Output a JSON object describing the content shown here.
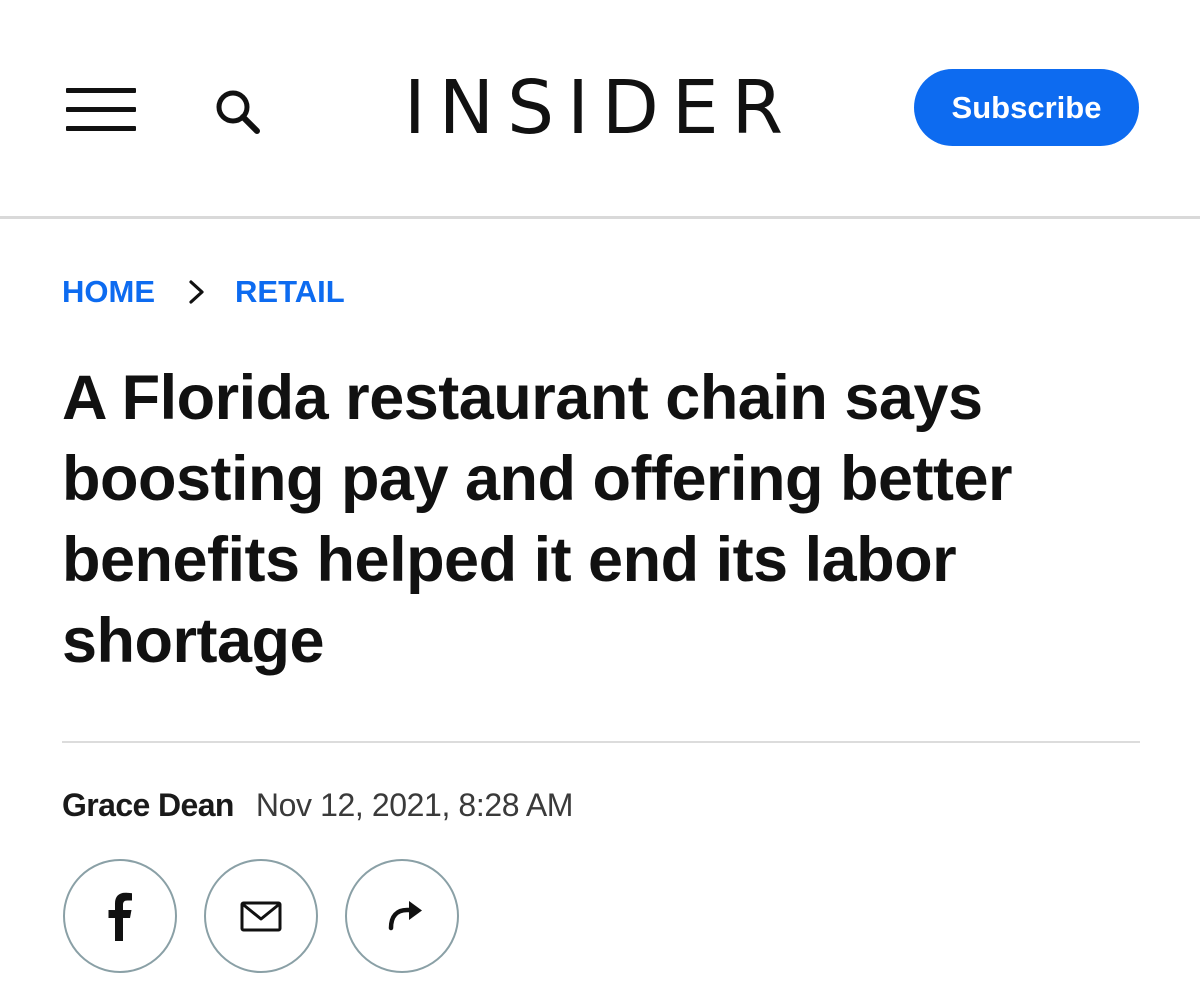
{
  "header": {
    "menu_icon": "hamburger-menu-icon",
    "search_icon": "search-icon",
    "logo_text": "INSIDER",
    "subscribe_label": "Subscribe",
    "accent_color": "#0d6bf0"
  },
  "breadcrumb": {
    "items": [
      {
        "label": "HOME"
      },
      {
        "label": "RETAIL"
      }
    ],
    "separator_icon": "chevron-right-icon"
  },
  "article": {
    "headline": "A Florida restaurant chain says boosting pay and offering better benefits helped it end its labor shortage",
    "author": "Grace Dean",
    "timestamp": "Nov 12, 2021, 8:28 AM"
  },
  "share": {
    "buttons": [
      {
        "icon": "facebook-icon"
      },
      {
        "icon": "email-icon"
      },
      {
        "icon": "share-arrow-icon"
      }
    ]
  }
}
